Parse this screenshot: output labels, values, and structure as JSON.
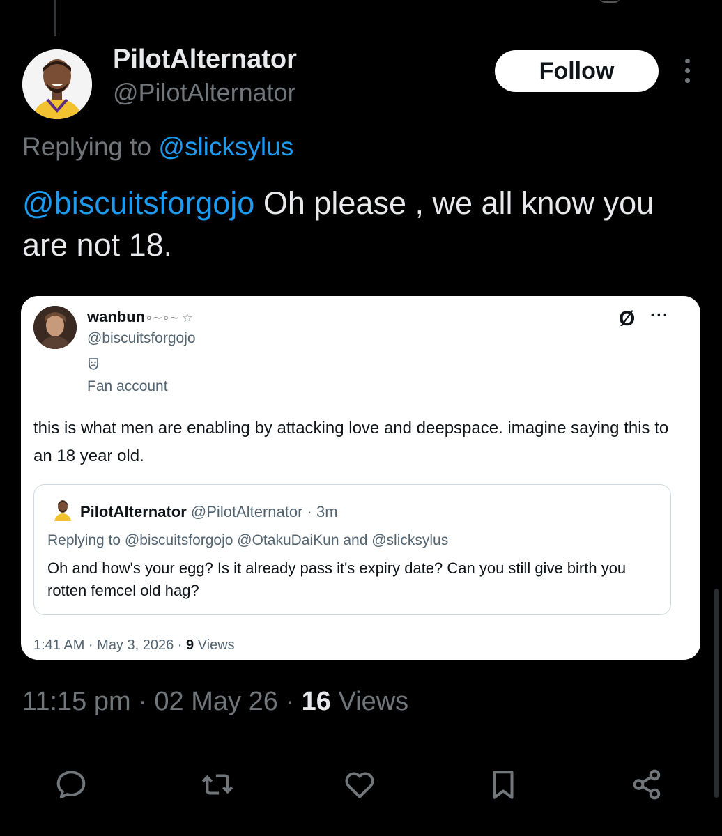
{
  "tweet": {
    "author_name": "PilotAlternator",
    "author_handle": "@PilotAlternator",
    "follow_label": "Follow",
    "replying_prefix": "Replying to ",
    "replying_handle": "@slicksylus",
    "text_mention": "@biscuitsforgojo",
    "text_body": " Oh please , we all know you are not 18.",
    "time": "11:15 pm",
    "date": "02 May 26",
    "views_count": "16",
    "views_label": "Views"
  },
  "quoted": {
    "author_name": "wanbun",
    "author_name_deco": "⁠∘∼∘∼ ☆",
    "author_handle": "@biscuitsforgojo",
    "label": "Fan account",
    "grok_glyph": "Ø",
    "more_glyph": "···",
    "text": "this is what men are enabling by attacking love and deepspace. imagine saying this to an 18 year old.",
    "nested": {
      "author_name": "PilotAlternator",
      "author_handle_time": "@PilotAlternator · 3m",
      "replying": "Replying to @biscuitsforgojo @OtakuDaiKun and @slicksylus",
      "text": "Oh and how's your egg? Is it already pass it's expiry date? Can you still give birth you rotten femcel old hag?"
    },
    "meta_prefix": "1:41 AM · May 3, 2026 · ",
    "views_count": "9",
    "views_label": " Views"
  },
  "actions": [
    {
      "name": "reply",
      "icon": "reply-icon"
    },
    {
      "name": "repost",
      "icon": "repost-icon"
    },
    {
      "name": "like",
      "icon": "like-icon"
    },
    {
      "name": "bookmark",
      "icon": "bookmark-icon"
    },
    {
      "name": "share",
      "icon": "share-icon"
    }
  ],
  "colors": {
    "background": "#000000",
    "link": "#1d9bf0",
    "muted": "#71767b",
    "text": "#e7e9ea"
  }
}
